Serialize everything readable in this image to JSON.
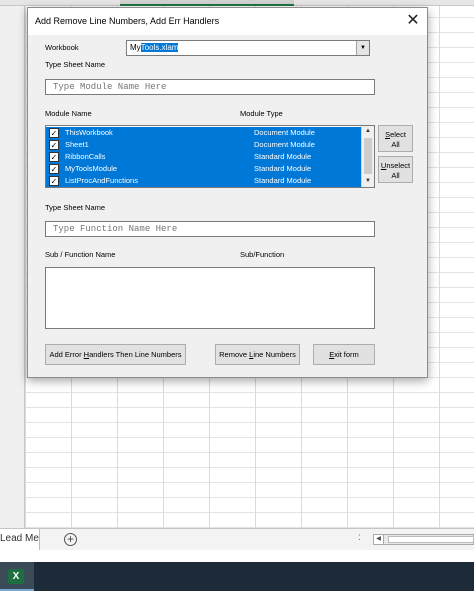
{
  "dialog": {
    "title": "Add Remove Line Numbers, Add Err Handlers",
    "close_glyph": "✕"
  },
  "workbook": {
    "label": "Workbook",
    "value_prefix": "My",
    "value_selected": "Tools.xlam",
    "dropdown_glyph": "▼"
  },
  "sheet1": {
    "label": "Type Sheet Name",
    "placeholder": "Type Module Name Here"
  },
  "modules": {
    "col_name": "Module Name",
    "col_type": "Module Type",
    "items": [
      {
        "name": "ThisWorkbook",
        "type": "Document Module",
        "checked": true
      },
      {
        "name": "Sheet1",
        "type": "Document Module",
        "checked": true
      },
      {
        "name": "RibbonCalls",
        "type": "Standard Module",
        "checked": true
      },
      {
        "name": "MyToolsModule",
        "type": "Standard Module",
        "checked": true
      },
      {
        "name": "ListProcAndFunctions",
        "type": "Standard Module",
        "checked": true
      }
    ],
    "check_glyph": "✓"
  },
  "side_buttons": {
    "select_u": "S",
    "select_rest": "elect",
    "select_line2": "All",
    "unselect_u": "U",
    "unselect_rest": "nselect",
    "unselect_line2": "All"
  },
  "sheet2": {
    "label": "Type Sheet Name",
    "placeholder": "Type Function Name Here"
  },
  "functions": {
    "col_name": "Sub / Function Name",
    "col_type": "Sub/Function"
  },
  "bottom_buttons": {
    "add_pre": "Add Error ",
    "add_u": "H",
    "add_post": "andlers Then Line Numbers",
    "remove_pre": "Remove ",
    "remove_u": "L",
    "remove_post": "ine Numbers",
    "exit_u": "E",
    "exit_post": "xit form"
  },
  "excel": {
    "sheet_tab": "Lead Me",
    "add_sheet_glyph": "+",
    "tabs_more": ":",
    "scroll_left_glyph": "◀",
    "app_icon_letter": "X"
  },
  "colors": {
    "selection": "#0078d7",
    "placeholder_text": "#e81123",
    "excel_green": "#217346"
  }
}
